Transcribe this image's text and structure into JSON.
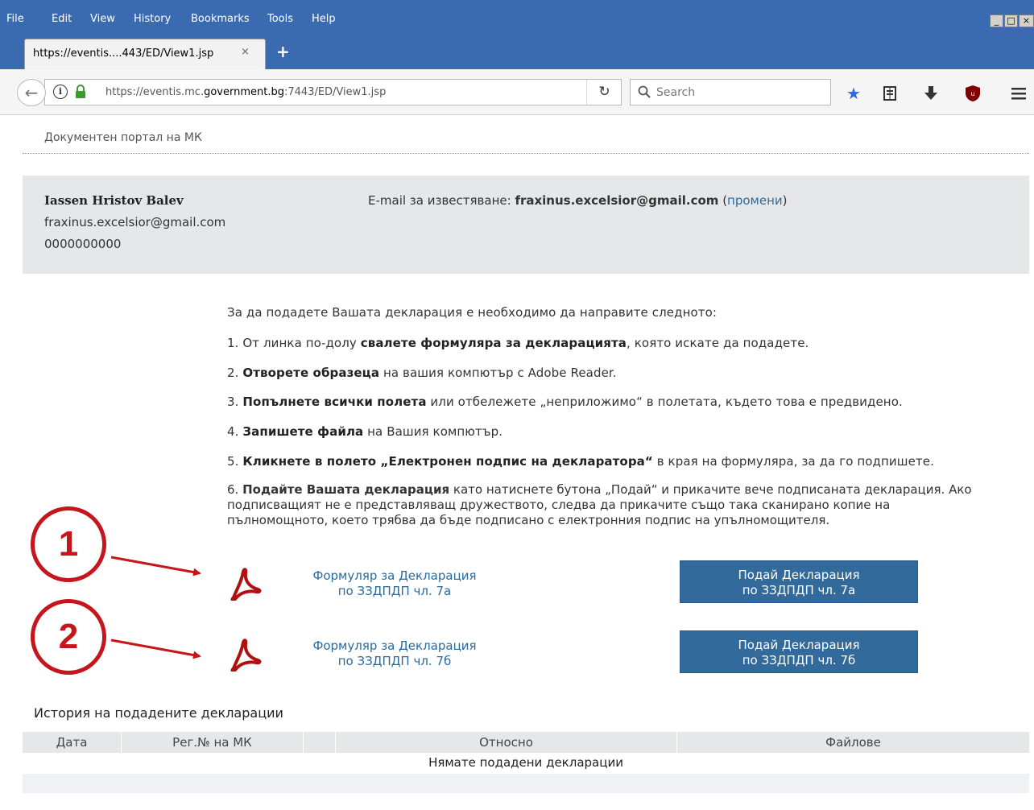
{
  "browser": {
    "menu": [
      "File",
      "Edit",
      "View",
      "History",
      "Bookmarks",
      "Tools",
      "Help"
    ],
    "window_controls": [
      "_",
      "□",
      "×"
    ],
    "tab_title": "https://eventis....443/ED/View1.jsp",
    "tab_close": "×",
    "new_tab": "+",
    "url_prefix": "https://eventis.mc.",
    "url_domain": "government.bg",
    "url_suffix": ":7443/ED/View1.jsp",
    "search_placeholder": "Search"
  },
  "page": {
    "portal_title": "Документен портал на МК",
    "user": {
      "name": "Iassen Hristov Balev",
      "email": "fraxinus.excelsior@gmail.com",
      "id": "0000000000"
    },
    "notify": {
      "label": "E-mail за известяване: ",
      "email": "fraxinus.excelsior@gmail.com",
      "change_open": " (",
      "change_link": "промени",
      "change_close": ")"
    },
    "instructions": {
      "intro": "За да подадете Вашата декларация е необходимо да направите следното:",
      "s1_a": "1. От линка по-долу ",
      "s1_b": "свалете формуляра за декларацията",
      "s1_c": ", която искате да подадете.",
      "s2_a": "2. ",
      "s2_b": "Отворете образеца",
      "s2_c": " на вашия компютър с Adobe Reader.",
      "s3_a": "3. ",
      "s3_b": "Попълнете всички полета",
      "s3_c": " или отбележете „неприложимо“ в полетата, където това е предвидено.",
      "s4_a": "4. ",
      "s4_b": "Запишете файла",
      "s4_c": " на Вашия компютър.",
      "s5_a": "5. ",
      "s5_b": "Кликнете в полето „Електронен подпис на декларатора“",
      "s5_c": " в края на формуляра, за да го подпишете.",
      "s6_a": "6. ",
      "s6_b": "Подайте Вашата декларация",
      "s6_c": " като натиснете бутона „Подай“ и прикачите вече подписаната декларация. Ако подписващият не е представляващ дружеството, следва да прикачите също така сканирано копие на пълномощното, което трябва да бъде подписано с електронния подпис на упълномощителя."
    },
    "forms": [
      {
        "marker": "1",
        "link_line1": "Формуляр за Декларация",
        "link_line2": "по ЗЗДПДП чл. 7а",
        "button_line1": "Подай Декларация",
        "button_line2": "по ЗЗДПДП чл. 7а"
      },
      {
        "marker": "2",
        "link_line1": "Формуляр за Декларация",
        "link_line2": "по ЗЗДПДП чл. 7б",
        "button_line1": "Подай Декларация",
        "button_line2": "по ЗЗДПДП чл. 7б"
      }
    ],
    "history": {
      "title": "История на подадените декларации",
      "columns": [
        "Дата",
        "Рег.№ на МК",
        "Относно",
        "Файлове"
      ],
      "empty_text": "Нямате подадени декларации"
    }
  },
  "colors": {
    "accent_button": "#336a9c",
    "link": "#2a6a9e",
    "annotation_red": "#c4161c",
    "titlebar": "#3a6ab0"
  }
}
